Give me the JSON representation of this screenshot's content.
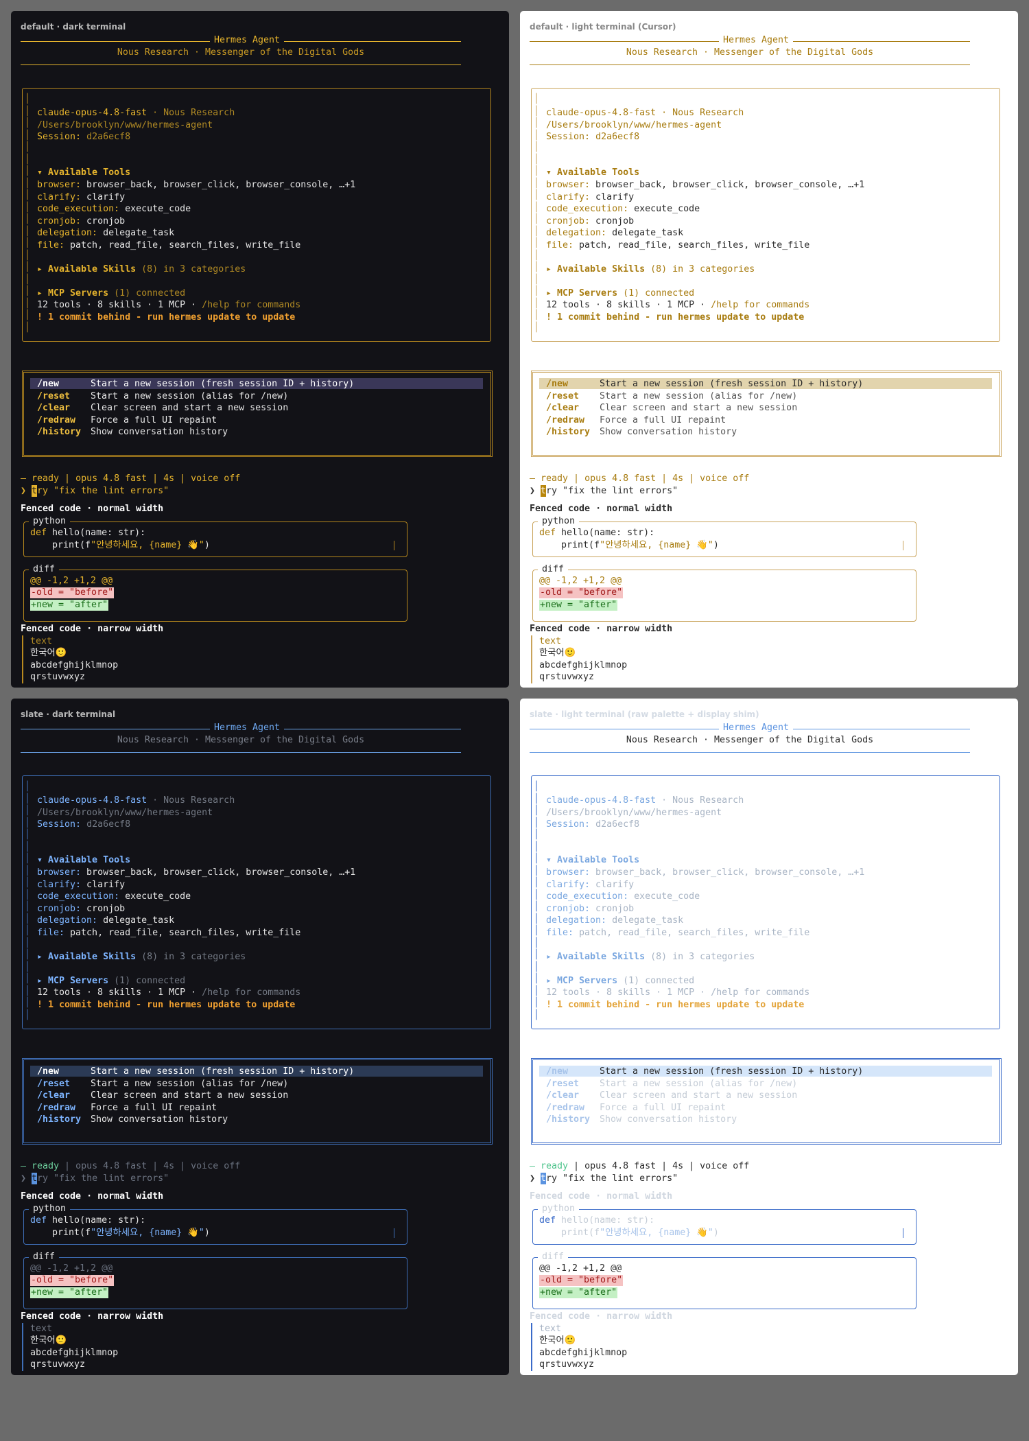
{
  "panels": [
    {
      "id": "tl",
      "caption": "default · dark terminal",
      "colors": {
        "bg": "#121217",
        "text": "#e6e6e6",
        "accent": "#e6b42d",
        "title": "#e6b42d",
        "subtitle": "#c99a24",
        "label": "#e6b42d",
        "value": "#e6e6e6",
        "dim": "#b08a24",
        "border": "#b98a1e",
        "selbg": "#3a3758",
        "seltext": "#ffffff",
        "warn": "#f0a030",
        "caption": "#b8b8b8",
        "cmd": "#f0c040",
        "desc": "#e6e6e6",
        "python": "#e6e6e6",
        "kw": "#e6b42d",
        "str": "#e6b42d",
        "hunk": "#e6b42d",
        "rmbg": "#f5c2c2",
        "rmfg": "#a01818",
        "addbg": "#c4f0c4",
        "addfg": "#1a6e1a",
        "fenced": "#ffffff",
        "narrow": "#e6e6e6",
        "ready": "#e6b42d",
        "status": "#e6b42d",
        "prompt": "#e6b42d"
      }
    },
    {
      "id": "tr",
      "caption": "default · light terminal (Cursor)",
      "colors": {
        "bg": "#ffffff",
        "text": "#2b2b2b",
        "accent": "#b8860b",
        "title": "#a87c10",
        "subtitle": "#a87c10",
        "label": "#a87c10",
        "value": "#2b2b2b",
        "dim": "#a87c10",
        "border": "#c9a35a",
        "selbg": "#e2d4ad",
        "seltext": "#2b2b2b",
        "warn": "#a87c10",
        "caption": "#888888",
        "cmd": "#a87c10",
        "desc": "#555555",
        "python": "#2b2b2b",
        "kw": "#a87c10",
        "str": "#a87c10",
        "hunk": "#a87c10",
        "rmbg": "#f5c2c2",
        "rmfg": "#a01818",
        "addbg": "#c4f0c4",
        "addfg": "#1a6e1a",
        "fenced": "#2b2b2b",
        "narrow": "#2b2b2b",
        "ready": "#a87c10",
        "status": "#a87c10",
        "prompt": "#2b2b2b"
      }
    },
    {
      "id": "bl",
      "caption": "slate · dark terminal",
      "colors": {
        "bg": "#121217",
        "text": "#e6e6e6",
        "accent": "#5b93e0",
        "title": "#6ea8f0",
        "subtitle": "#7a7f8a",
        "label": "#7db4ff",
        "value": "#e6e6e6",
        "dim": "#737984",
        "border": "#3f6fb8",
        "selbg": "#2b3a55",
        "seltext": "#ffffff",
        "warn": "#f0a030",
        "caption": "#b8b8b8",
        "cmd": "#7db4ff",
        "desc": "#e6e6e6",
        "python": "#e6e6e6",
        "kw": "#7db4ff",
        "str": "#7db4ff",
        "hunk": "#6b7280",
        "rmbg": "#f5c2c2",
        "rmfg": "#a01818",
        "addbg": "#c4f0c4",
        "addfg": "#1a6e1a",
        "fenced": "#ffffff",
        "narrow": "#e6e6e6",
        "ready": "#6fd3a0",
        "status": "#6b7280",
        "prompt": "#6b7280"
      }
    },
    {
      "id": "br",
      "caption": "slate · light terminal (raw palette + display shim)",
      "colors": {
        "bg": "#ffffff",
        "text": "#2b2b2b",
        "accent": "#5b93e0",
        "title": "#5b93e0",
        "subtitle": "#2b2b2b",
        "label": "#7aa7e0",
        "value": "#a8b4c4",
        "dim": "#a8b4c4",
        "border": "#3a6bc9",
        "selbg": "#d5e6fa",
        "seltext": "#2b2b2b",
        "warn": "#e3a43a",
        "caption": "#d4dbe4",
        "cmd": "#a8c4ea",
        "desc": "#c4ccd6",
        "python": "#c4ccd6",
        "kw": "#3a6bc9",
        "str": "#a8c4ea",
        "hunk": "#2b2b2b",
        "rmbg": "#f5c2c2",
        "rmfg": "#a01818",
        "addbg": "#c4f0c4",
        "addfg": "#1a6e1a",
        "fenced": "#cfd6df",
        "narrow": "#2b2b2b",
        "ready": "#4cc38a",
        "status": "#2b2b2b",
        "prompt": "#2b2b2b"
      }
    }
  ],
  "banner": {
    "title": "Hermes Agent",
    "subtitle": "Nous Research · Messenger of the Digital Gods"
  },
  "info": {
    "model": "claude-opus-4.8-fast",
    "provider": " · Nous Research",
    "path": "/Users/brooklyn/www/hermes-agent",
    "session_label": "Session: ",
    "session_id": "d2a6ecf8"
  },
  "tools": {
    "header": "▾ Available Tools",
    "rows": [
      {
        "label": "browser:",
        "value": " browser_back, browser_click, browser_console, …+1"
      },
      {
        "label": "clarify:",
        "value": " clarify"
      },
      {
        "label": "code_execution:",
        "value": " execute_code"
      },
      {
        "label": "cronjob:",
        "value": " cronjob"
      },
      {
        "label": "delegation:",
        "value": " delegate_task"
      },
      {
        "label": "file:",
        "value": " patch, read_file, search_files, write_file"
      }
    ]
  },
  "skills": {
    "header": "▸ Available Skills",
    "count": " (8)",
    "rest": " in 3 categories"
  },
  "mcp": {
    "header": "▸ MCP Servers",
    "status": " (1) connected",
    "summary": "12 tools · 8 skills · 1 MCP · ",
    "help": "/help for commands",
    "warning": "! 1 commit behind - run hermes update to update"
  },
  "commands": [
    {
      "cmd": "/new",
      "desc": "Start a new session (fresh session ID + history)"
    },
    {
      "cmd": "/reset",
      "desc": "Start a new session (alias for /new)"
    },
    {
      "cmd": "/clear",
      "desc": "Clear screen and start a new session"
    },
    {
      "cmd": "/redraw",
      "desc": "Force a full UI repaint"
    },
    {
      "cmd": "/history",
      "desc": "Show conversation history"
    }
  ],
  "status": {
    "ready": "— ready",
    "rest": " | opus 4.8 fast | 4s | voice off",
    "prompt_symbol": "❯ ",
    "cursor_char": "t",
    "prompt_text": "ry \"fix the lint errors\""
  },
  "fenced_normal": {
    "heading": "Fenced code · normal width",
    "python": {
      "lang": "python",
      "kw": "def",
      "sig": " hello(name: str):",
      "print_pre": "    print(f",
      "print_str": "\"안녕하세요, {name} 👋\"",
      "print_post": ")"
    },
    "diff": {
      "lang": "diff",
      "hunk": "@@ -1,2 +1,2 @@",
      "removed": "-old = \"before\"",
      "added": "+new = \"after\""
    }
  },
  "fenced_narrow": {
    "heading": "Fenced code · narrow width",
    "lines": [
      "text",
      "한국어🙂",
      "abcdefghijklmnop",
      "qrstuvwxyz"
    ]
  }
}
